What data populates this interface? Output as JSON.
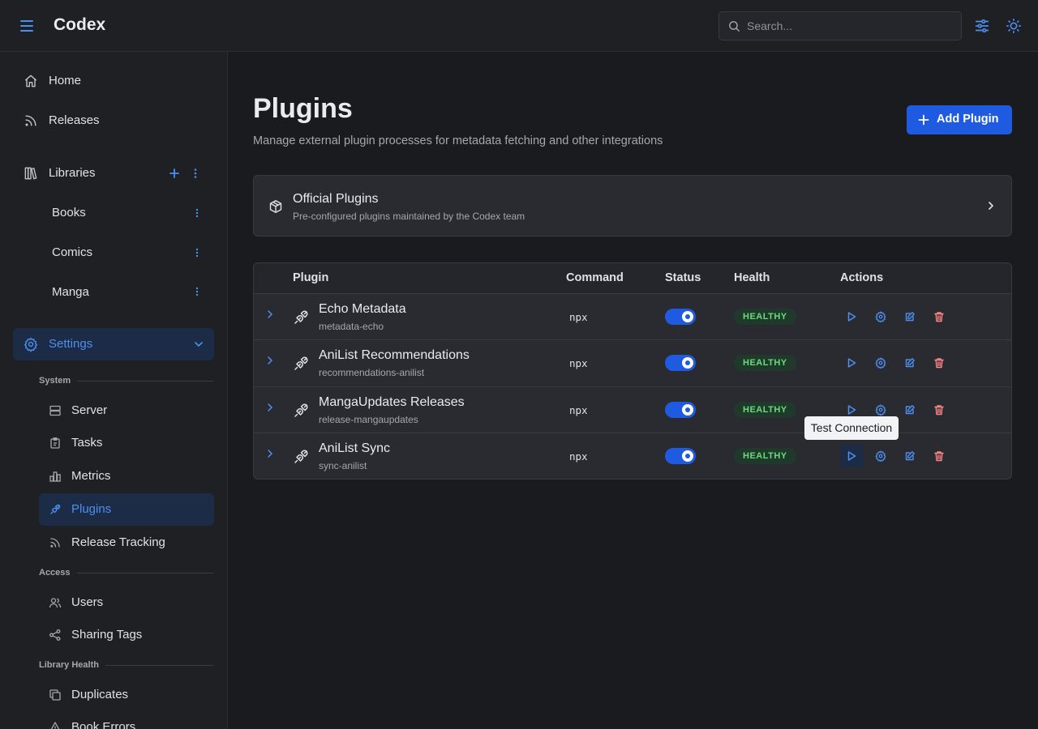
{
  "header": {
    "brand": "Codex",
    "search_placeholder": "Search..."
  },
  "sidebar": {
    "home": "Home",
    "releases": "Releases",
    "libraries": "Libraries",
    "library_items": [
      "Books",
      "Comics",
      "Manga"
    ],
    "settings": "Settings",
    "sections": {
      "system": "System",
      "access": "Access",
      "library_health": "Library Health"
    },
    "system_items": [
      "Server",
      "Tasks",
      "Metrics",
      "Plugins",
      "Release Tracking"
    ],
    "access_items": [
      "Users",
      "Sharing Tags"
    ],
    "health_items": [
      "Duplicates",
      "Book Errors"
    ]
  },
  "main": {
    "title": "Plugins",
    "subtitle": "Manage external plugin processes for metadata fetching and other integrations",
    "add_button": "Add Plugin",
    "official": {
      "title": "Official Plugins",
      "description": "Pre-configured plugins maintained by the Codex team"
    },
    "table": {
      "columns": [
        "Plugin",
        "Command",
        "Status",
        "Health",
        "Actions"
      ],
      "rows": [
        {
          "name": "Echo Metadata",
          "slug": "metadata-echo",
          "command": "npx",
          "enabled": true,
          "health": "HEALTHY"
        },
        {
          "name": "AniList Recommendations",
          "slug": "recommendations-anilist",
          "command": "npx",
          "enabled": true,
          "health": "HEALTHY"
        },
        {
          "name": "MangaUpdates Releases",
          "slug": "release-mangaupdates",
          "command": "npx",
          "enabled": true,
          "health": "HEALTHY"
        },
        {
          "name": "AniList Sync",
          "slug": "sync-anilist",
          "command": "npx",
          "enabled": true,
          "health": "HEALTHY"
        }
      ]
    },
    "tooltip": "Test Connection"
  },
  "colors": {
    "accent": "#4d8ef0",
    "primary_button": "#1f5be0",
    "healthy": "#69db7c",
    "danger": "#ff8787"
  }
}
